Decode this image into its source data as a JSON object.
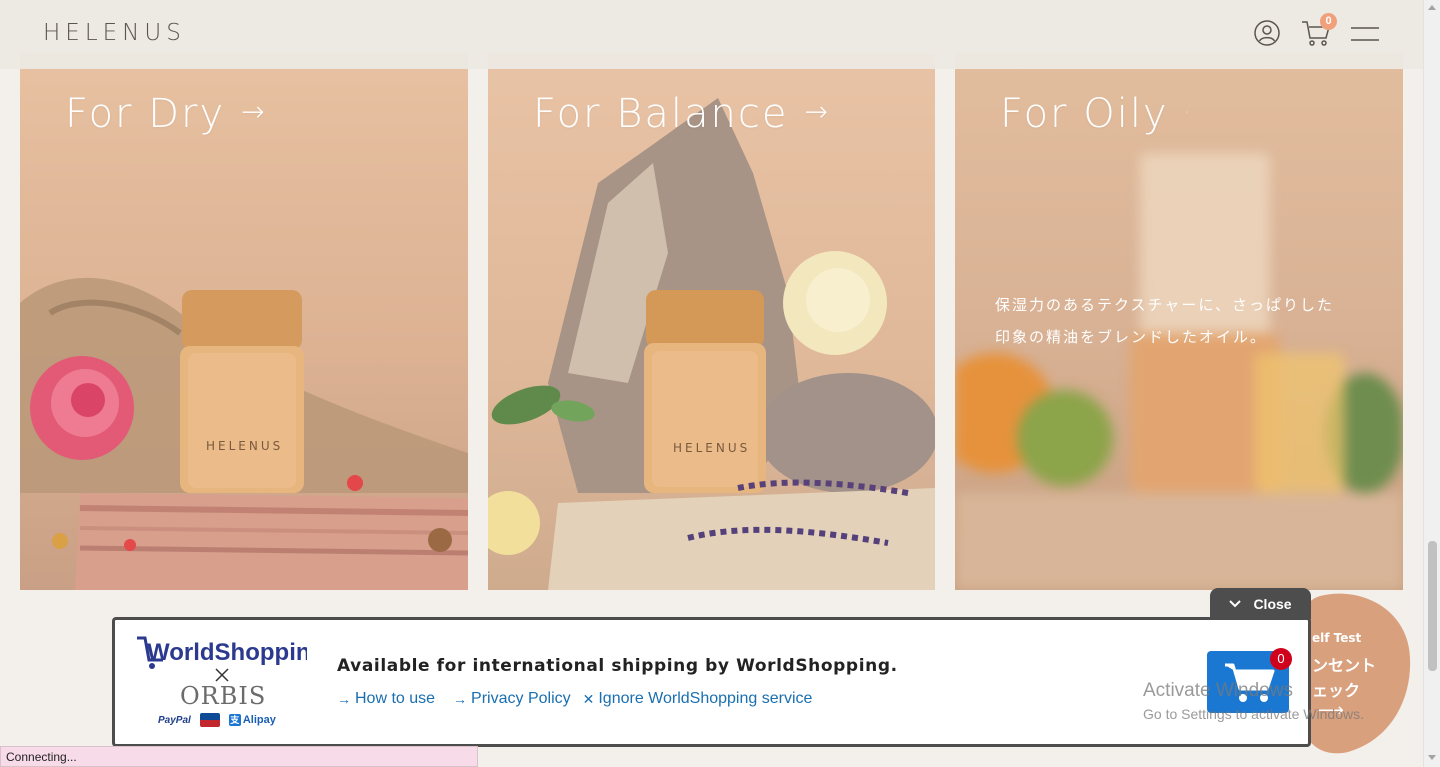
{
  "header": {
    "logo": "HELENUS",
    "cart_count": "0",
    "icons": [
      "user-icon",
      "cart-icon",
      "menu-icon"
    ]
  },
  "cards": [
    {
      "title": "For Dry",
      "arrow": "→",
      "product_label": "HELENUS"
    },
    {
      "title": "For Balance",
      "arrow": "→",
      "product_label": "HELENUS"
    },
    {
      "title": "For Oily",
      "arrow": "·",
      "description_line1": "保湿力のあるテクスチャーに、さっぱりした",
      "description_line2": "印象の精油をブレンドしたオイル。"
    }
  ],
  "self_test": {
    "line1": "elf Test",
    "line2": "ンセント",
    "line3": "ェック",
    "arrow": "⟶"
  },
  "worldshopping": {
    "close_label": "Close",
    "brand": "WorldShopping",
    "partner": "ORBIS",
    "payments": {
      "paypal": "PayPal",
      "alipay": "Alipay"
    },
    "headline": "Available for international shipping by WorldShopping.",
    "links": {
      "how_to_use": "How to use",
      "privacy_policy": "Privacy Policy",
      "ignore": "Ignore WorldShopping service"
    },
    "cart_count": "0"
  },
  "watermark": {
    "line1": "Activate Windows",
    "line2": "Go to Settings to activate Windows."
  },
  "status_text": "Connecting...",
  "colors": {
    "accent_orange": "#f0a07a",
    "ws_blue": "#1a78d2",
    "ws_link": "#1a6fb0",
    "ws_badge_red": "#d0021b"
  }
}
